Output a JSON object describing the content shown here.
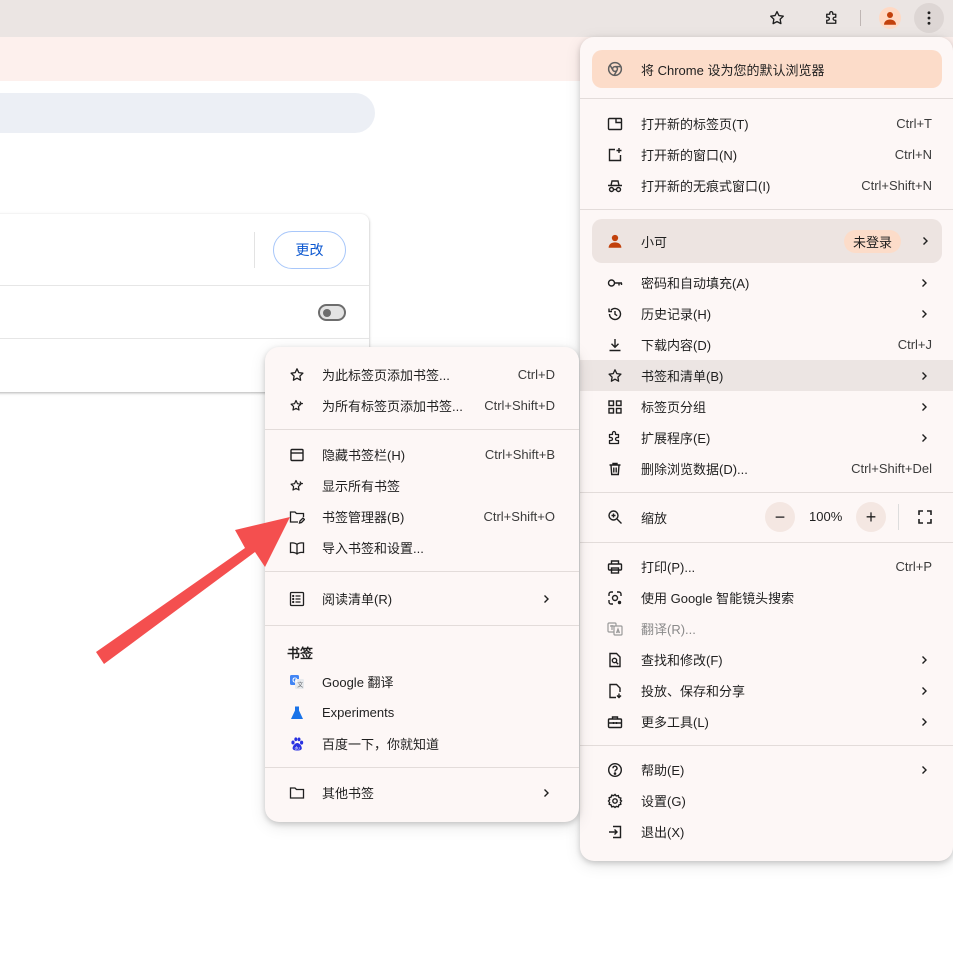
{
  "colors": {
    "toolbar": "#ebe5e3",
    "menu_bg": "#fdf7f6",
    "highlight": "#ece5e3",
    "banner": "#fcdcc9",
    "accent_blue": "#0b57d0",
    "arrow": "#f44f4f"
  },
  "toolbar": {
    "icons": [
      "star-icon",
      "extensions-icon",
      "profile-avatar-icon",
      "kebab-menu-icon"
    ]
  },
  "page": {
    "change_button": "更改"
  },
  "main_menu": {
    "default_banner": "将 Chrome 设为您的默认浏览器",
    "group1": [
      {
        "icon": "new-tab-icon",
        "label": "打开新的标签页(T)",
        "shortcut": "Ctrl+T"
      },
      {
        "icon": "new-window-icon",
        "label": "打开新的窗口(N)",
        "shortcut": "Ctrl+N"
      },
      {
        "icon": "incognito-icon",
        "label": "打开新的无痕式窗口(I)",
        "shortcut": "Ctrl+Shift+N"
      }
    ],
    "profile": {
      "name": "小可",
      "badge": "未登录"
    },
    "group2": [
      {
        "icon": "key-icon",
        "label": "密码和自动填充(A)",
        "shortcut": ""
      },
      {
        "icon": "history-icon",
        "label": "历史记录(H)",
        "shortcut": ""
      },
      {
        "icon": "download-icon",
        "label": "下载内容(D)",
        "shortcut": "Ctrl+J"
      },
      {
        "icon": "bookmark-star-icon",
        "label": "书签和清单(B)",
        "shortcut": ""
      },
      {
        "icon": "tab-groups-icon",
        "label": "标签页分组",
        "shortcut": ""
      },
      {
        "icon": "extensions-icon",
        "label": "扩展程序(E)",
        "shortcut": ""
      },
      {
        "icon": "trash-icon",
        "label": "删除浏览数据(D)...",
        "shortcut": "Ctrl+Shift+Del"
      }
    ],
    "zoom": {
      "label": "缩放",
      "minus": "−",
      "value": "100%",
      "plus": "+"
    },
    "group3": [
      {
        "icon": "print-icon",
        "label": "打印(P)...",
        "shortcut": "Ctrl+P"
      },
      {
        "icon": "google-lens-icon",
        "label": "使用 Google 智能镜头搜索",
        "shortcut": ""
      },
      {
        "icon": "translate-icon",
        "label": "翻译(R)...",
        "shortcut": ""
      },
      {
        "icon": "find-icon",
        "label": "查找和修改(F)",
        "shortcut": ""
      },
      {
        "icon": "cast-save-share-icon",
        "label": "投放、保存和分享",
        "shortcut": ""
      },
      {
        "icon": "toolbox-icon",
        "label": "更多工具(L)",
        "shortcut": ""
      }
    ],
    "group4": [
      {
        "icon": "help-icon",
        "label": "帮助(E)",
        "shortcut": ""
      },
      {
        "icon": "settings-gear-icon",
        "label": "设置(G)",
        "shortcut": ""
      },
      {
        "icon": "exit-icon",
        "label": "退出(X)",
        "shortcut": ""
      }
    ]
  },
  "bookmarks_submenu": {
    "group1": [
      {
        "icon": "star-outline-icon",
        "label": "为此标签页添加书签...",
        "shortcut": "Ctrl+D"
      },
      {
        "icon": "stars-outline-icon",
        "label": "为所有标签页添加书签...",
        "shortcut": "Ctrl+Shift+D"
      }
    ],
    "group2": [
      {
        "icon": "bookmark-bar-icon",
        "label": "隐藏书签栏(H)",
        "shortcut": "Ctrl+Shift+B"
      },
      {
        "icon": "stars-outline-icon",
        "label": "显示所有书签",
        "shortcut": ""
      },
      {
        "icon": "folder-edit-icon",
        "label": "书签管理器(B)",
        "shortcut": "Ctrl+Shift+O"
      },
      {
        "icon": "import-book-icon",
        "label": "导入书签和设置...",
        "shortcut": ""
      }
    ],
    "reading_list": {
      "icon": "reading-list-icon",
      "label": "阅读清单(R)"
    },
    "bookmarks_section_title": "书签",
    "bookmarks": [
      {
        "icon": "google-translate-favicon",
        "label": "Google 翻译"
      },
      {
        "icon": "experiments-flask-icon",
        "label": "Experiments"
      },
      {
        "icon": "baidu-paw-icon",
        "label": "百度一下，你就知道"
      }
    ],
    "other_bookmarks": {
      "icon": "folder-icon",
      "label": "其他书签"
    }
  }
}
